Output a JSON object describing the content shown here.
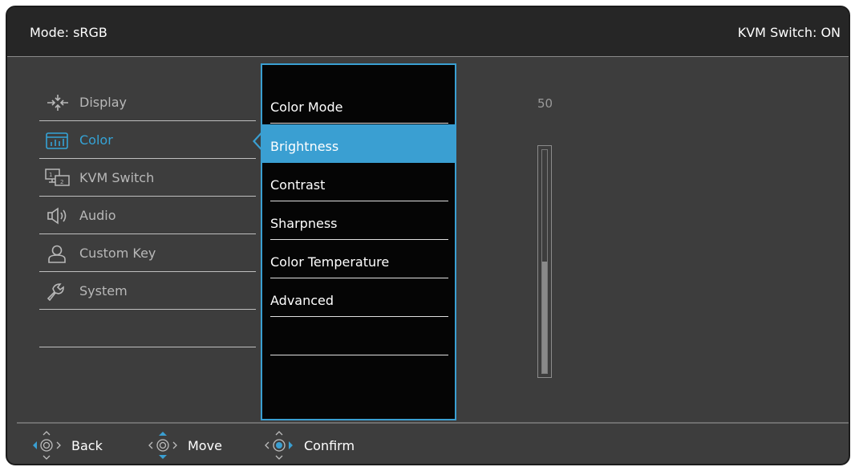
{
  "header": {
    "mode": "Mode: sRGB",
    "kvm_status": "KVM Switch: ON"
  },
  "main_menu": {
    "items": [
      {
        "label": "Display",
        "icon": "display-icon",
        "active": false
      },
      {
        "label": "Color",
        "icon": "color-icon",
        "active": true
      },
      {
        "label": "KVM Switch",
        "icon": "kvm-switch-icon",
        "active": false
      },
      {
        "label": "Audio",
        "icon": "audio-icon",
        "active": false
      },
      {
        "label": "Custom Key",
        "icon": "custom-key-icon",
        "active": false
      },
      {
        "label": "System",
        "icon": "system-icon",
        "active": false
      }
    ]
  },
  "submenu": {
    "items": [
      {
        "label": "Color Mode"
      },
      {
        "label": "Brightness",
        "selected": true
      },
      {
        "label": "Contrast"
      },
      {
        "label": "Sharpness"
      },
      {
        "label": "Color Temperature"
      },
      {
        "label": "Advanced"
      }
    ]
  },
  "brightness": {
    "value_label": "50",
    "level_fraction": 0.5
  },
  "footer": {
    "back": "Back",
    "move": "Move",
    "confirm": "Confirm"
  },
  "colors": {
    "accent": "#3a9fd2",
    "background": "#3d3d3d",
    "header": "#262626",
    "submenu_bg": "#050505"
  }
}
